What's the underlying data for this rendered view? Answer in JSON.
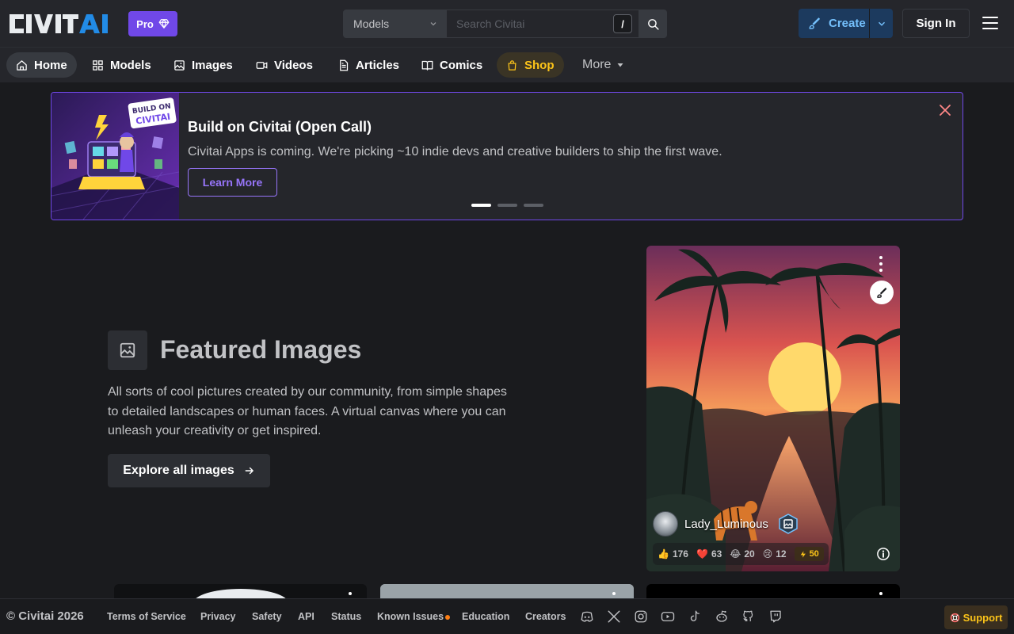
{
  "header": {
    "logo_text": "CIVITAI",
    "pro_label": "Pro",
    "search": {
      "category": "Models",
      "placeholder": "Search Civitai",
      "shortcut": "/"
    },
    "create_label": "Create",
    "signin_label": "Sign In"
  },
  "nav": {
    "items": [
      {
        "label": "Home",
        "icon": "home-icon",
        "active": true
      },
      {
        "label": "Models",
        "icon": "grid-icon"
      },
      {
        "label": "Images",
        "icon": "image-icon"
      },
      {
        "label": "Videos",
        "icon": "video-icon"
      },
      {
        "label": "Articles",
        "icon": "article-icon"
      },
      {
        "label": "Comics",
        "icon": "book-icon"
      },
      {
        "label": "Shop",
        "icon": "shopping-bag-icon"
      }
    ],
    "more_label": "More"
  },
  "banner": {
    "image_text": "BUILD ON CIVITAI",
    "title": "Build on Civitai (Open Call)",
    "description": "Civitai Apps is coming. We're picking ~10 indie devs and creative builders to ship the first wave.",
    "button_label": "Learn More"
  },
  "featured": {
    "title": "Featured Images",
    "description": "All sorts of cool pictures created by our community, from simple shapes to detailed landscapes or human faces. A virtual canvas where you can unleash your creativity or get inspired.",
    "button_label": "Explore all images"
  },
  "card": {
    "username": "Lady_Luminous",
    "reactions": {
      "like": "176",
      "heart": "63",
      "laugh": "20",
      "cry": "12",
      "buzz": "50"
    }
  },
  "footer": {
    "copyright": "© Civitai 2026",
    "links": [
      "Terms of Service",
      "Privacy",
      "Safety",
      "API",
      "Status",
      "Known Issues",
      "Education",
      "Creators"
    ],
    "support_label": "Support"
  },
  "colors": {
    "accent": "#7048e8",
    "create": "#74c0fc",
    "shop": "#fcc419",
    "background": "#1a1b1e"
  }
}
